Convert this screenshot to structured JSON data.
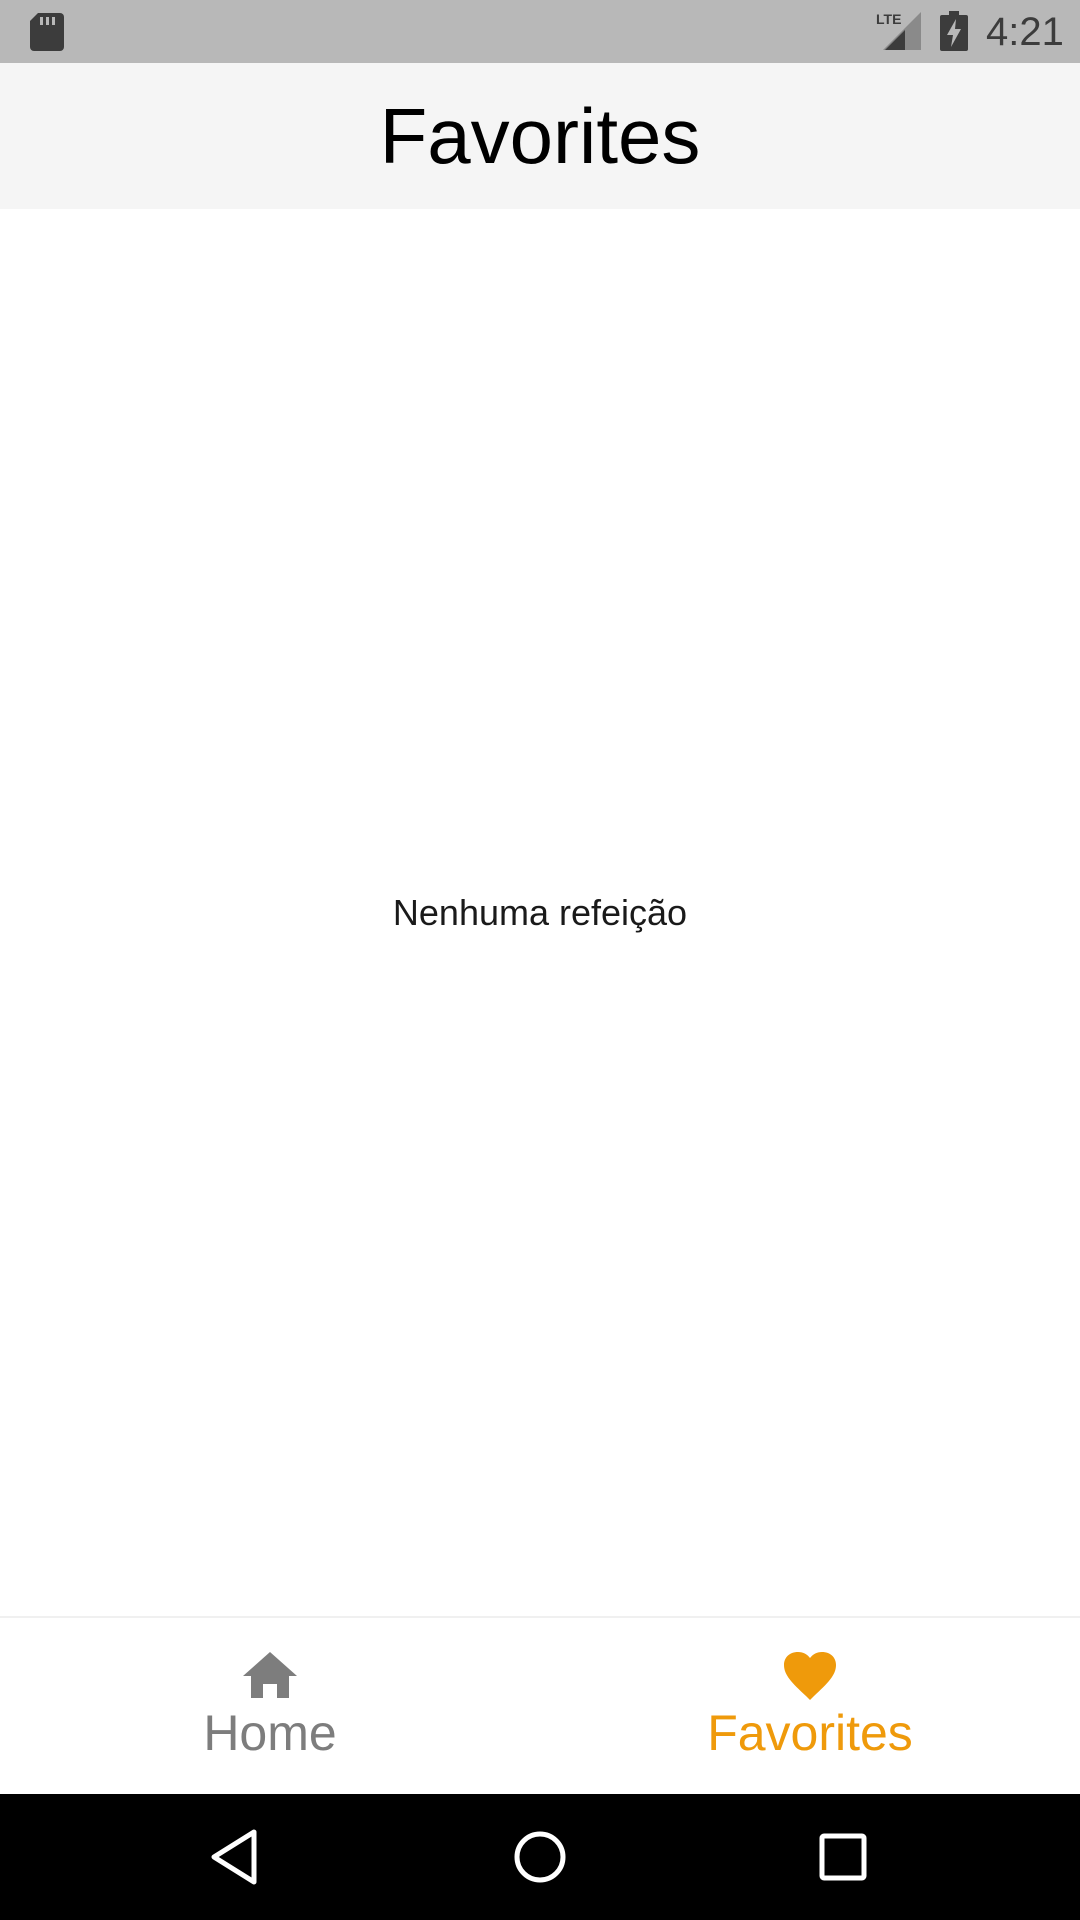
{
  "status_bar": {
    "time": "4:21",
    "network": "LTE",
    "icons": [
      "sd-card-icon",
      "lte-signal-icon",
      "battery-charging-icon"
    ]
  },
  "app_bar": {
    "title": "Favorites"
  },
  "content": {
    "empty_message": "Nenhuma refeição"
  },
  "bottom_nav": {
    "items": [
      {
        "label": "Home",
        "icon": "home-icon",
        "selected": false,
        "color": "#7d7d7d"
      },
      {
        "label": "Favorites",
        "icon": "heart-icon",
        "selected": true,
        "color": "#ef9a0b"
      }
    ]
  },
  "system_nav": {
    "buttons": [
      "back-icon",
      "home-circle-icon",
      "recents-icon"
    ]
  },
  "colors": {
    "status_bar": "#b8b8b8",
    "app_bar": "#f5f5f5",
    "accent": "#ef9a0b",
    "inactive": "#7d7d7d",
    "system_nav": "#000000"
  }
}
